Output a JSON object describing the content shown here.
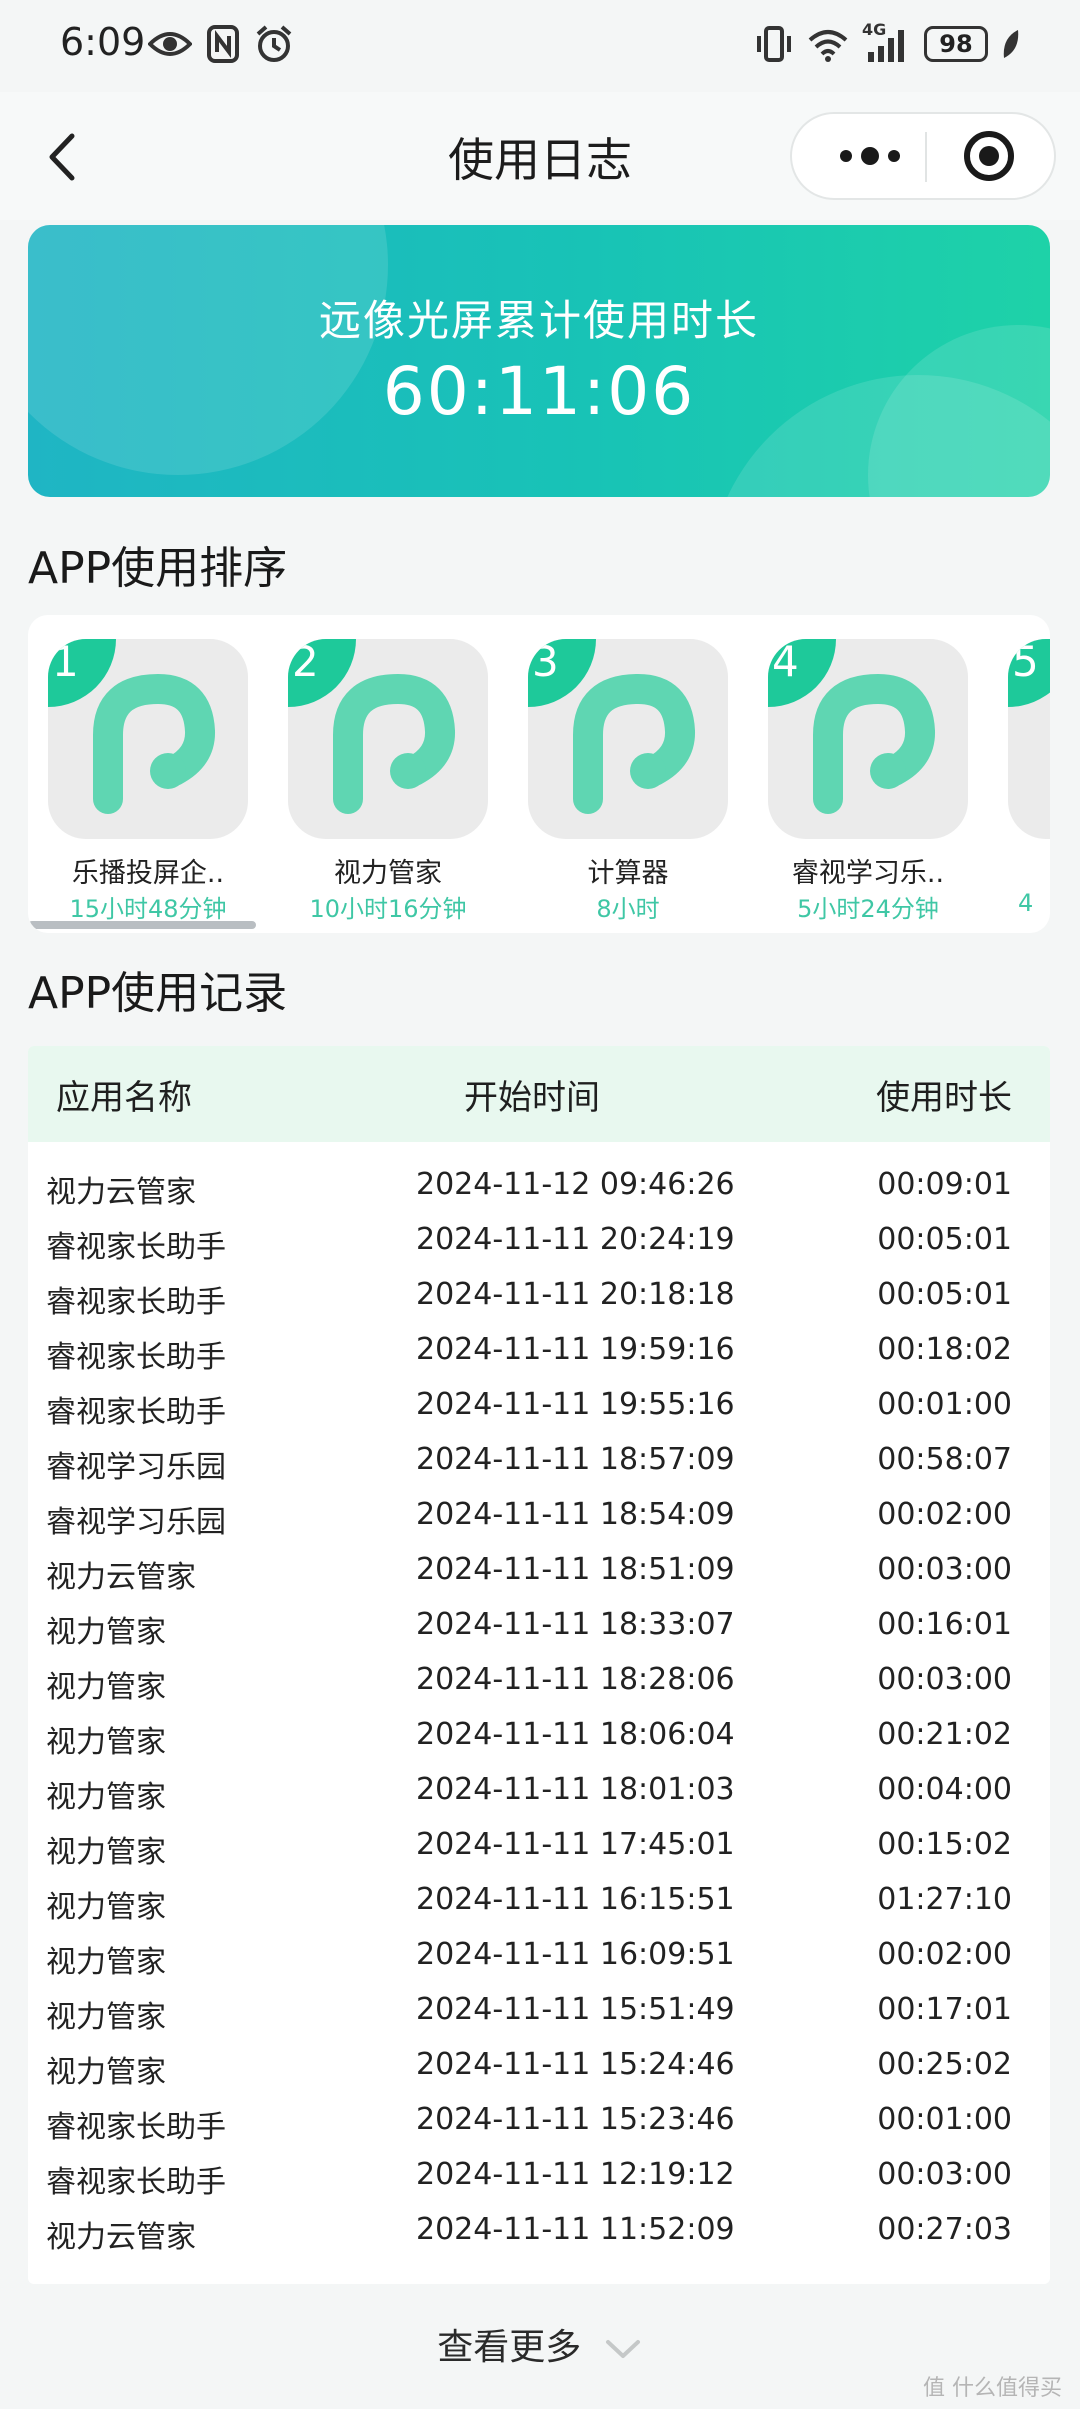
{
  "status_bar": {
    "time": "6:09",
    "network": "4G",
    "battery": "98"
  },
  "nav": {
    "title": "使用日志"
  },
  "banner": {
    "label": "远像光屏累计使用时长",
    "total_time": "60:11:06"
  },
  "ranking": {
    "title": "APP使用排序",
    "items": [
      {
        "rank": "1",
        "name": "乐播投屏企..",
        "time": "15小时48分钟"
      },
      {
        "rank": "2",
        "name": "视力管家",
        "time": "10小时16分钟"
      },
      {
        "rank": "3",
        "name": "计算器",
        "time": "8小时"
      },
      {
        "rank": "4",
        "name": "睿视学习乐..",
        "time": "5小时24分钟"
      },
      {
        "rank": "5",
        "name": "",
        "time": "4"
      }
    ]
  },
  "records": {
    "title": "APP使用记录",
    "columns": [
      "应用名称",
      "开始时间",
      "使用时长"
    ],
    "rows": [
      [
        "视力云管家",
        "2024-11-12 09:46:26",
        "00:09:01"
      ],
      [
        "睿视家长助手",
        "2024-11-11 20:24:19",
        "00:05:01"
      ],
      [
        "睿视家长助手",
        "2024-11-11 20:18:18",
        "00:05:01"
      ],
      [
        "睿视家长助手",
        "2024-11-11 19:59:16",
        "00:18:02"
      ],
      [
        "睿视家长助手",
        "2024-11-11 19:55:16",
        "00:01:00"
      ],
      [
        "睿视学习乐园",
        "2024-11-11 18:57:09",
        "00:58:07"
      ],
      [
        "睿视学习乐园",
        "2024-11-11 18:54:09",
        "00:02:00"
      ],
      [
        "视力云管家",
        "2024-11-11 18:51:09",
        "00:03:00"
      ],
      [
        "视力管家",
        "2024-11-11 18:33:07",
        "00:16:01"
      ],
      [
        "视力管家",
        "2024-11-11 18:28:06",
        "00:03:00"
      ],
      [
        "视力管家",
        "2024-11-11 18:06:04",
        "00:21:02"
      ],
      [
        "视力管家",
        "2024-11-11 18:01:03",
        "00:04:00"
      ],
      [
        "视力管家",
        "2024-11-11 17:45:01",
        "00:15:02"
      ],
      [
        "视力管家",
        "2024-11-11 16:15:51",
        "01:27:10"
      ],
      [
        "视力管家",
        "2024-11-11 16:09:51",
        "00:02:00"
      ],
      [
        "视力管家",
        "2024-11-11 15:51:49",
        "00:17:01"
      ],
      [
        "视力管家",
        "2024-11-11 15:24:46",
        "00:25:02"
      ],
      [
        "睿视家长助手",
        "2024-11-11 15:23:46",
        "00:01:00"
      ],
      [
        "睿视家长助手",
        "2024-11-11 12:19:12",
        "00:03:00"
      ],
      [
        "视力云管家",
        "2024-11-11 11:52:09",
        "00:27:03"
      ]
    ],
    "more_label": "查看更多"
  },
  "watermark": "值 什么值得买",
  "colors": {
    "accent_green": "#1ec99a",
    "banner_start": "#1fb5c4",
    "banner_end": "#1ed2a8",
    "table_header_bg": "#e8f8ef",
    "rank_time": "#3fc7a5"
  },
  "icons": [
    "eye-icon",
    "nfc-icon",
    "alarm-icon",
    "vibrate-icon",
    "wifi-icon",
    "signal-icon",
    "battery-icon",
    "leaf-icon",
    "back-icon",
    "more-icon",
    "target-icon",
    "app-logo-icon",
    "chevron-down-icon"
  ]
}
